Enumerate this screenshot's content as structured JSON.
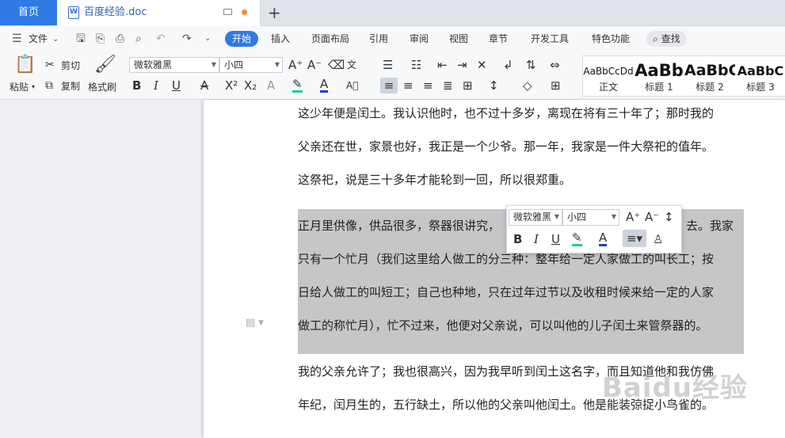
{
  "tabs": {
    "home": "首页",
    "doc_title": "百度经验.doc",
    "new_tab": "+"
  },
  "menubar": {
    "file": "文件",
    "items": [
      "开始",
      "插入",
      "页面布局",
      "引用",
      "审阅",
      "视图",
      "章节",
      "开发工具",
      "特色功能"
    ],
    "active": "开始",
    "search": "查找"
  },
  "ribbon": {
    "paste": "粘贴",
    "cut": "剪切",
    "copy": "复制",
    "format_painter": "格式刷",
    "font_name": "微软雅黑",
    "font_size": "小四",
    "styles": [
      {
        "preview": "AaBbCcDd",
        "name": "正文"
      },
      {
        "preview": "AaBb",
        "name": "标题 1"
      },
      {
        "preview": "AaBbC",
        "name": "标题 2"
      },
      {
        "preview": "AaBbC",
        "name": "标题 3"
      }
    ]
  },
  "document": {
    "paragraph1": [
      "这少年便是闰土。我认识他时，也不过十多岁，离现在将有三十年了；那时我的",
      "父亲还在世，家景也好，我正是一个少爷。那一年，我家是一件大祭祀的值年。",
      "这祭祀，说是三十多年才能轮到一回，所以很郑重。"
    ],
    "paragraph2": [
      "正月里供像，供品很多，祭器很讲究，",
      "去。我家",
      "只有一个忙月（我们这里给人做工的分三种：整年给一定人家做工的叫长工；按",
      "日给人做工的叫短工；自己也种地，只在过年过节以及收租时候来给一定的人家",
      "做工的称忙月），忙不过来，他便对父亲说，可以叫他的儿子闰土来管祭器的。"
    ],
    "paragraph3": [
      "我的父亲允许了；我也很高兴，因为我早听到闰土这名字，而且知道他和我仿佛",
      "年纪，闰月生的，五行缺土，所以他的父亲叫他闰土。他是能装弶捉小鸟雀的。"
    ]
  },
  "floating_toolbar": {
    "font_name": "微软雅黑",
    "font_size": "小四"
  },
  "watermark": "Baidu经验",
  "colors": {
    "accent": "#2f7ae5",
    "highlight_bar": "#20c997",
    "font_color_bar": "#1b3fd1",
    "selection": "#c5c6c8"
  }
}
